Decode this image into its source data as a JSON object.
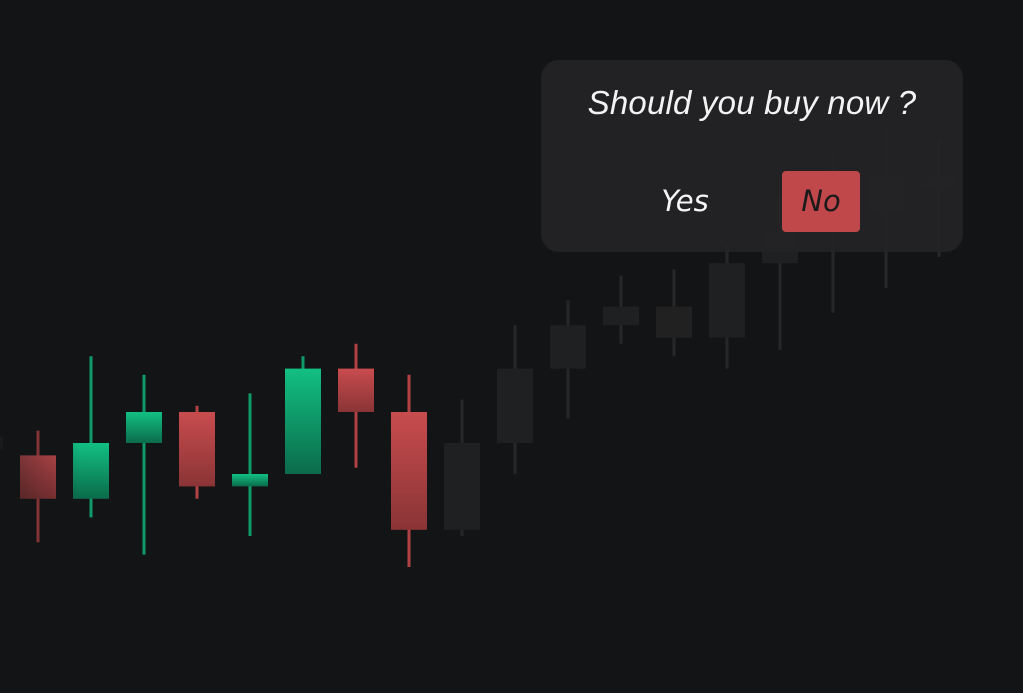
{
  "dialog": {
    "question": "Should you buy now ?",
    "yes_label": "Yes",
    "no_label": "No"
  },
  "colors": {
    "background": "#131416",
    "bullish": "#10b07a",
    "bearish": "#c0484a",
    "faded": "#2a2a2c",
    "dialog_bg": "#242426",
    "no_button_bg": "#c0484a"
  },
  "chart_data": {
    "type": "candlestick",
    "candles": [
      {
        "open": 116,
        "close": 114,
        "high": 120,
        "low": 110,
        "direction": "bear",
        "faded": true
      },
      {
        "open": 113,
        "close": 106,
        "high": 117,
        "low": 99,
        "direction": "bear"
      },
      {
        "open": 106,
        "close": 115,
        "high": 129,
        "low": 103,
        "direction": "bull"
      },
      {
        "open": 115,
        "close": 120,
        "high": 126,
        "low": 97,
        "direction": "bull"
      },
      {
        "open": 120,
        "close": 108,
        "high": 121,
        "low": 106,
        "direction": "bear"
      },
      {
        "open": 108,
        "close": 110,
        "high": 123,
        "low": 100,
        "direction": "bull"
      },
      {
        "open": 110,
        "close": 127,
        "high": 129,
        "low": 110,
        "direction": "bull"
      },
      {
        "open": 127,
        "close": 120,
        "high": 131,
        "low": 111,
        "direction": "bear"
      },
      {
        "open": 120,
        "close": 101,
        "high": 126,
        "low": 95,
        "direction": "bear"
      },
      {
        "open": 101,
        "close": 115,
        "high": 122,
        "low": 100,
        "direction": "bull",
        "faded": true
      },
      {
        "open": 115,
        "close": 127,
        "high": 134,
        "low": 110,
        "direction": "bull",
        "faded": true
      },
      {
        "open": 127,
        "close": 134,
        "high": 138,
        "low": 119,
        "direction": "bull",
        "faded": true
      },
      {
        "open": 134,
        "close": 137,
        "high": 142,
        "low": 131,
        "direction": "bull",
        "faded": true
      },
      {
        "open": 137,
        "close": 132,
        "high": 143,
        "low": 129,
        "direction": "bear",
        "faded": true
      },
      {
        "open": 132,
        "close": 144,
        "high": 147,
        "low": 127,
        "direction": "bull",
        "faded": true
      },
      {
        "open": 144,
        "close": 149,
        "high": 155,
        "low": 130,
        "direction": "bull",
        "faded": true
      },
      {
        "open": 149,
        "close": 152,
        "high": 162,
        "low": 136,
        "direction": "bull",
        "faded": true
      },
      {
        "open": 152,
        "close": 158,
        "high": 166,
        "low": 140,
        "direction": "bull",
        "faded": true
      },
      {
        "open": 158,
        "close": 156,
        "high": 164,
        "low": 145,
        "direction": "bear",
        "faded": true
      }
    ],
    "ylim": [
      80,
      180
    ],
    "grid": false,
    "title": "",
    "xlabel": "",
    "ylabel": ""
  }
}
